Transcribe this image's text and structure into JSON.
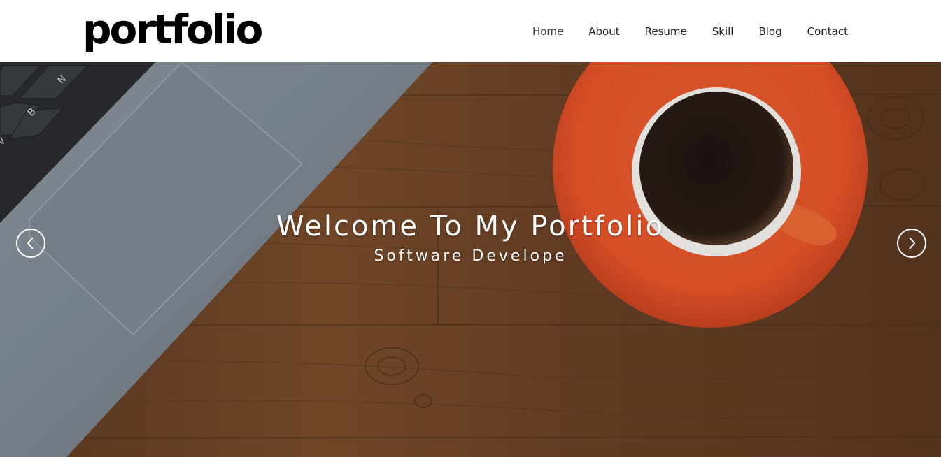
{
  "logo": {
    "text": "portfolio"
  },
  "nav": {
    "items": [
      {
        "label": "Home"
      },
      {
        "label": "About"
      },
      {
        "label": "Resume"
      },
      {
        "label": "Skill"
      },
      {
        "label": "Blog"
      },
      {
        "label": "Contact"
      }
    ],
    "active": "Home"
  },
  "hero": {
    "title": "Welcome To My Portfolio",
    "subtitle": "Software Develope",
    "prev_icon": "chevron-left-icon",
    "next_icon": "chevron-right-icon"
  },
  "colors": {
    "accent": "#ffffff",
    "header_bg": "#ffffff",
    "wood": "#6b4326",
    "saucer": "#e8562a"
  }
}
